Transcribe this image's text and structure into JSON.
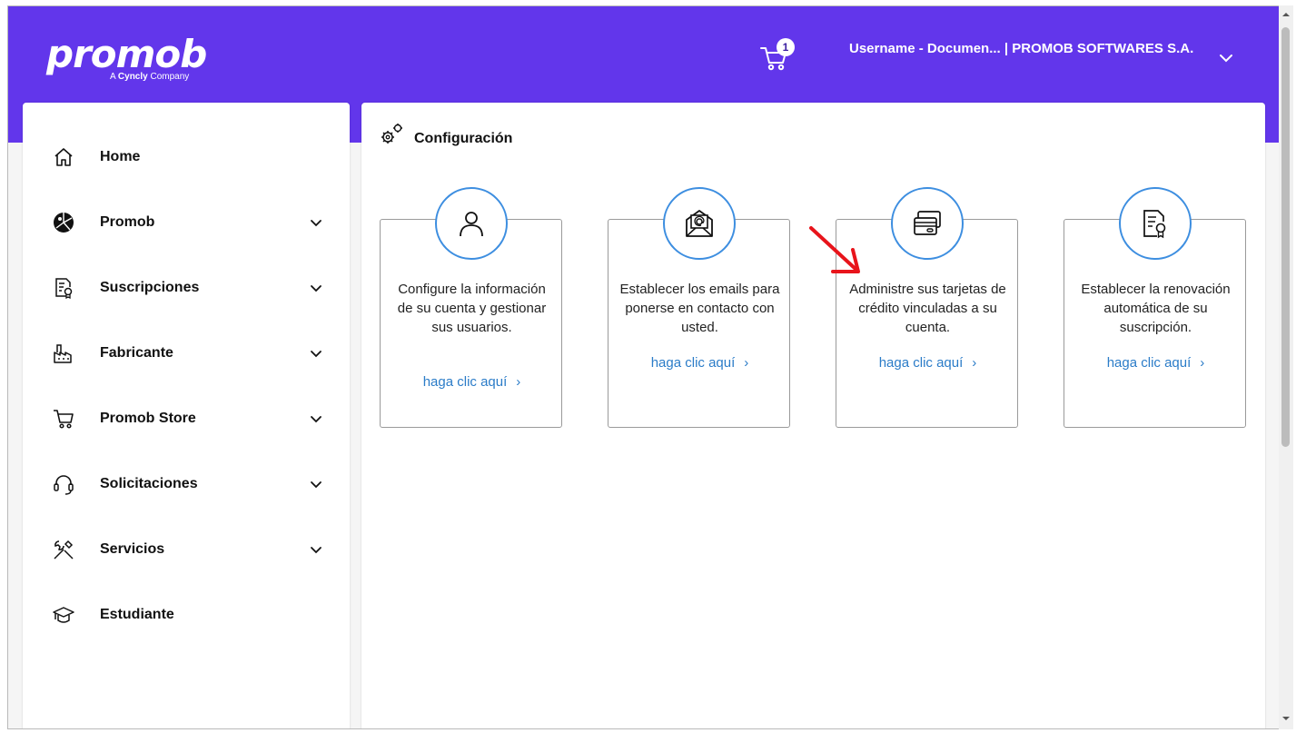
{
  "brand": {
    "logo_text": "promob",
    "tagline_prefix": "A",
    "tagline_brand": "Cyncly",
    "tagline_suffix": "Company",
    "primary_color": "#6236eb",
    "link_color": "#2b7cc8",
    "accent_circle_color": "#3d8ee0"
  },
  "header": {
    "cart_icon": "cart-icon",
    "cart_count": "1",
    "user_label": "Username - Documen... | PROMOB SOFTWARES S.A.",
    "user_menu_icon": "chevron-down-icon"
  },
  "sidebar": {
    "items": [
      {
        "label": "Home",
        "icon": "home-icon",
        "has_children": false
      },
      {
        "label": "Promob",
        "icon": "promob-logo-icon",
        "has_children": true
      },
      {
        "label": "Suscripciones",
        "icon": "certificate-document-icon",
        "has_children": true
      },
      {
        "label": "Fabricante",
        "icon": "factory-icon",
        "has_children": true
      },
      {
        "label": "Promob Store",
        "icon": "cart-icon",
        "has_children": true
      },
      {
        "label": "Solicitaciones",
        "icon": "headset-icon",
        "has_children": true
      },
      {
        "label": "Servicios",
        "icon": "tools-icon",
        "has_children": true
      },
      {
        "label": "Estudiante",
        "icon": "graduation-cap-icon",
        "has_children": false
      }
    ]
  },
  "main": {
    "title": "Configuración",
    "title_icon": "gears-icon",
    "cards": [
      {
        "icon": "user-icon",
        "text": "Configure la información de su cuenta y gestionar sus usuarios.",
        "link": "haga clic aquí"
      },
      {
        "icon": "email-at-icon",
        "text": "Establecer los emails para ponerse en contacto con usted.",
        "link": "haga clic aquí"
      },
      {
        "icon": "credit-cards-icon",
        "text": "Administre sus tarjetas de crédito vinculadas a su cuenta.",
        "link": "haga clic aquí"
      },
      {
        "icon": "certificate-document-icon",
        "text": "Establecer la renovación automática de su suscripción.",
        "link": "haga clic aquí"
      }
    ]
  },
  "annotation": {
    "icon": "red-arrow-icon",
    "color": "#e8141b"
  }
}
